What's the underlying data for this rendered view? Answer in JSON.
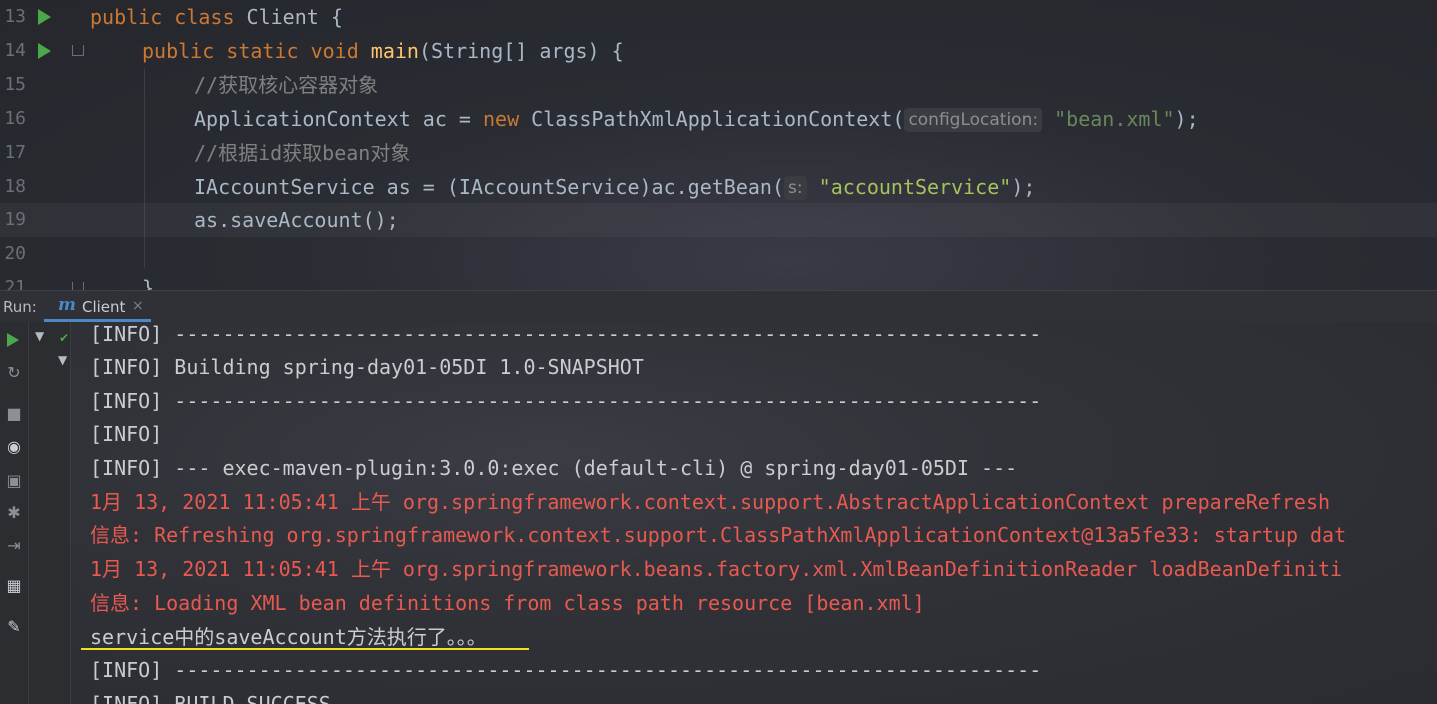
{
  "editor": {
    "lines": [
      {
        "num": "13",
        "segments": [
          [
            "kw",
            "public class "
          ],
          [
            "plain",
            "Client {"
          ]
        ]
      },
      {
        "num": "14",
        "segments": [
          [
            "kw",
            "public static void "
          ],
          [
            "fn",
            "main"
          ],
          [
            "plain",
            "(String[] args) {"
          ]
        ]
      },
      {
        "num": "15",
        "segments": [
          [
            "cm",
            "//获取核心容器对象"
          ]
        ]
      },
      {
        "num": "16",
        "segments": [
          [
            "plain",
            "ApplicationContext ac = "
          ],
          [
            "kw",
            "new "
          ],
          [
            "plain",
            "ClassPathXmlApplicationContext("
          ],
          [
            "hint",
            "configLocation:"
          ],
          [
            "str",
            " \"bean.xml\""
          ],
          [
            "plain",
            ");"
          ]
        ]
      },
      {
        "num": "17",
        "segments": [
          [
            "cm",
            "//根据id获取bean对象"
          ]
        ]
      },
      {
        "num": "18",
        "segments": [
          [
            "plain",
            "IAccountService as = (IAccountService)ac.getBean("
          ],
          [
            "hint",
            "s:"
          ],
          [
            "str2",
            " \"accountService\""
          ],
          [
            "plain",
            ");"
          ]
        ]
      },
      {
        "num": "19",
        "segments": [
          [
            "plain",
            "as.saveAccount();"
          ]
        ]
      },
      {
        "num": "20",
        "segments": []
      },
      {
        "num": "21",
        "segments": [
          [
            "plain",
            "}"
          ]
        ]
      }
    ]
  },
  "run_panel": {
    "label": "Run:",
    "tab_icon": "m",
    "tab_label": "Client",
    "tab_close": "×"
  },
  "console": {
    "lines": [
      {
        "style": "info",
        "text": "[INFO] ------------------------------------------------------------------------"
      },
      {
        "style": "info",
        "text": "[INFO] Building spring-day01-05DI 1.0-SNAPSHOT"
      },
      {
        "style": "info",
        "text": "[INFO] ------------------------------------------------------------------------"
      },
      {
        "style": "info",
        "text": "[INFO]"
      },
      {
        "style": "info",
        "text": "[INFO] --- exec-maven-plugin:3.0.0:exec (default-cli) @ spring-day01-05DI ---"
      },
      {
        "style": "err",
        "text": "1月 13, 2021 11:05:41 上午 org.springframework.context.support.AbstractApplicationContext prepareRefresh"
      },
      {
        "style": "err",
        "text": "信息: Refreshing org.springframework.context.support.ClassPathXmlApplicationContext@13a5fe33: startup dat"
      },
      {
        "style": "err",
        "text": "1月 13, 2021 11:05:41 上午 org.springframework.beans.factory.xml.XmlBeanDefinitionReader loadBeanDefiniti"
      },
      {
        "style": "err",
        "text": "信息: Loading XML bean definitions from class path resource [bean.xml]"
      },
      {
        "style": "info",
        "text": "service中的saveAccount方法执行了。。。"
      },
      {
        "style": "info",
        "text": "[INFO] ------------------------------------------------------------------------"
      },
      {
        "style": "info",
        "text": "[INFO] BUILD SUCCESS"
      }
    ]
  },
  "toolbar_icons": [
    "run-icon",
    "rerun-icon",
    "stop-icon",
    "eye-icon",
    "camera-icon",
    "debug-icon",
    "exit-icon",
    "layout-icon",
    "pin-icon"
  ]
}
